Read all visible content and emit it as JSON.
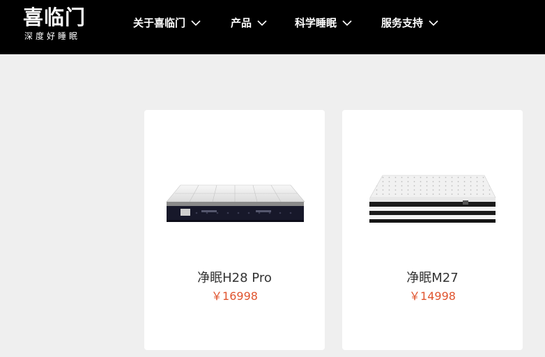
{
  "brand": {
    "name": "喜临门",
    "slogan": "深度好睡眠"
  },
  "nav": {
    "items": [
      {
        "label": "关于喜临门",
        "icon": "chevron-down-icon"
      },
      {
        "label": "产品",
        "icon": "chevron-down-icon"
      },
      {
        "label": "科学睡眠",
        "icon": "chevron-down-icon"
      },
      {
        "label": "服务支持",
        "icon": "chevron-down-icon"
      }
    ]
  },
  "products": [
    {
      "name": "净眠H28 Pro",
      "price": "￥16998",
      "image": "mattress-image"
    },
    {
      "name": "净眠M27",
      "price": "￥14998",
      "image": "mattress-image"
    }
  ],
  "colors": {
    "header_bg": "#000000",
    "page_bg": "#efefef",
    "card_bg": "#ffffff",
    "price": "#e0542e",
    "nav_text": "#ffffff"
  }
}
